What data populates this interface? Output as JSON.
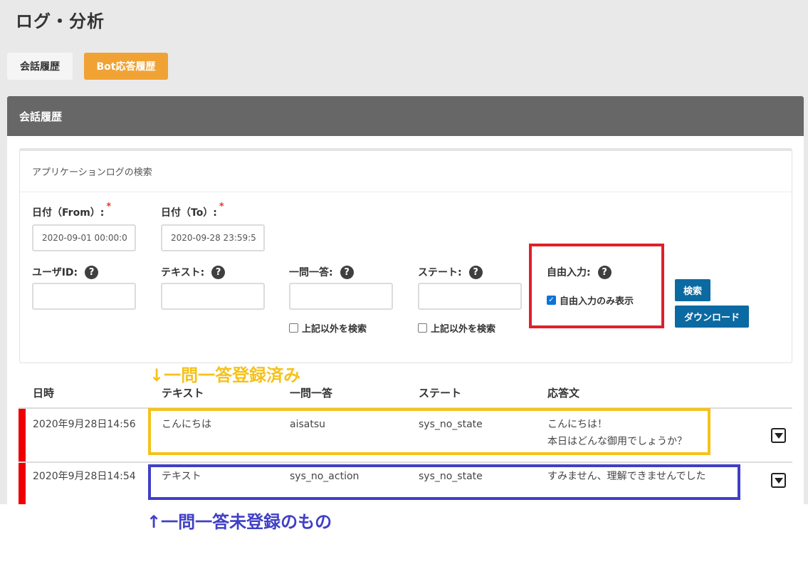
{
  "page": {
    "title": "ログ・分析"
  },
  "tabs": [
    {
      "label": "会話履歴"
    },
    {
      "label": "Bot応答履歴"
    }
  ],
  "panel": {
    "title": "会話履歴"
  },
  "search": {
    "title": "アプリケーションログの検索",
    "date_from": {
      "label": "日付（From）:",
      "required_mark": "*",
      "value": "2020-09-01 00:00:0"
    },
    "date_to": {
      "label": "日付（To）:",
      "required_mark": "*",
      "value": "2020-09-28 23:59:5"
    },
    "user_id": {
      "label": "ユーザID:",
      "value": ""
    },
    "text": {
      "label": "テキスト:",
      "value": ""
    },
    "qa": {
      "label": "一問一答:",
      "value": "",
      "exclude_label": "上記以外を検索",
      "exclude_checked": false
    },
    "state": {
      "label": "ステート:",
      "value": "",
      "exclude_label": "上記以外を検索",
      "exclude_checked": false
    },
    "free_input": {
      "label": "自由入力:",
      "only_label": "自由入力のみ表示",
      "only_checked": true
    },
    "help_glyph": "?",
    "search_button": "検索",
    "download_button": "ダウンロード"
  },
  "table": {
    "headers": {
      "datetime": "日時",
      "text": "テキスト",
      "qa": "一問一答",
      "state": "ステート",
      "response": "応答文"
    },
    "rows": [
      {
        "datetime": "2020年9月28日14:56",
        "text": "こんにちは",
        "qa": "aisatsu",
        "state": "sys_no_state",
        "response_line1": "こんにちは！",
        "response_line2": "本日はどんな御用でしょうか？"
      },
      {
        "datetime": "2020年9月28日14:54",
        "text": "テキスト",
        "qa": "sys_no_action",
        "state": "sys_no_state",
        "response_line1": "すみません、理解できませんでした",
        "response_line2": ""
      }
    ]
  },
  "annotations": {
    "registered": "↓一問一答登録済み",
    "unregistered": "↑一問一答未登録のもの"
  },
  "colors": {
    "accent_orange": "#f0a334",
    "header_gray": "#676767",
    "button_blue": "#0b6aa2",
    "annotation_yellow": "#f5c21b",
    "annotation_blue": "#3f3fc8",
    "annotation_red": "#e0202a",
    "row_flag_red": "#ee0000"
  }
}
